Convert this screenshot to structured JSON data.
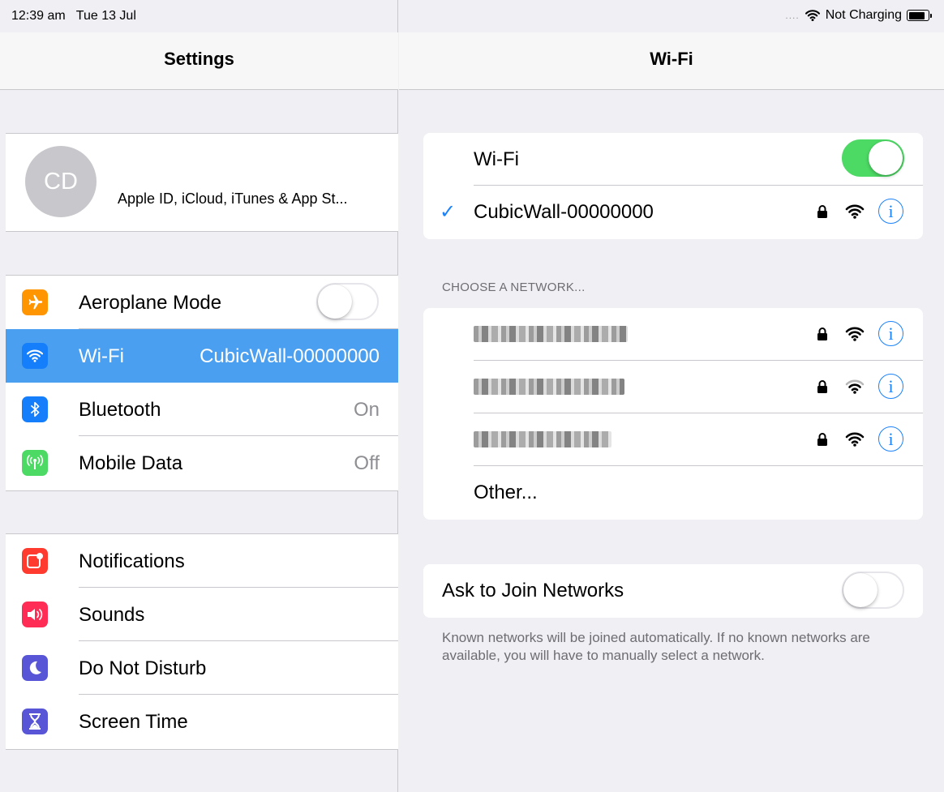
{
  "status_bar": {
    "time": "12:39 am",
    "date": "Tue 13 Jul",
    "signal_dots": "....",
    "charging": "Not Charging",
    "battery_level": 0.85
  },
  "settings": {
    "title": "Settings",
    "profile": {
      "initials": "CD",
      "label": "Apple ID, iCloud, iTunes & App St..."
    },
    "connectivity": [
      {
        "label": "Aeroplane Mode",
        "icon": "aeroplane-icon",
        "color": "#ff9500",
        "toggle": false
      },
      {
        "label": "Wi-Fi",
        "value": "CubicWall-00000000",
        "icon": "wifi-icon",
        "color": "#157efb",
        "selected": true
      },
      {
        "label": "Bluetooth",
        "value": "On",
        "icon": "bluetooth-icon",
        "color": "#157efb"
      },
      {
        "label": "Mobile Data",
        "value": "Off",
        "icon": "antenna-icon",
        "color": "#4cd964"
      }
    ],
    "system": [
      {
        "label": "Notifications",
        "icon": "notifications-icon",
        "color": "#ff3b30"
      },
      {
        "label": "Sounds",
        "icon": "speaker-icon",
        "color": "#ff2d55"
      },
      {
        "label": "Do Not Disturb",
        "icon": "moon-icon",
        "color": "#5856d6"
      },
      {
        "label": "Screen Time",
        "icon": "hourglass-icon",
        "color": "#5856d6"
      }
    ]
  },
  "wifi": {
    "title": "Wi-Fi",
    "toggle_label": "Wi-Fi",
    "toggle_on": true,
    "connected_network": "CubicWall-00000000",
    "choose_label": "CHOOSE A NETWORK...",
    "networks": [
      {
        "name_hidden": true,
        "secured": true,
        "signal": "strong"
      },
      {
        "name_hidden": true,
        "secured": true,
        "signal": "medium"
      },
      {
        "name_hidden": true,
        "secured": true,
        "signal": "strong"
      }
    ],
    "other_label": "Other...",
    "ask_join_label": "Ask to Join Networks",
    "ask_join_on": false,
    "footnote": "Known networks will be joined automatically. If no known networks are available, you will have to manually select a network."
  },
  "colors": {
    "accent": "#1a82fb",
    "selection": "#4a9ff1",
    "toggle_on": "#4cd964"
  }
}
